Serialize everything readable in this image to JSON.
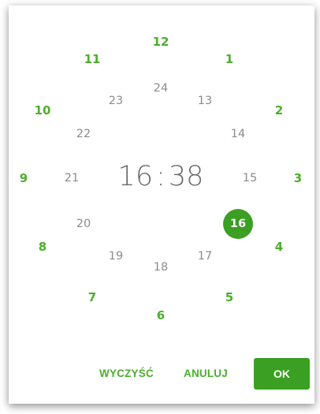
{
  "time_display": {
    "hours": "16",
    "separator": ":",
    "minutes": "38"
  },
  "clock": {
    "outer_hours": [
      "12",
      "1",
      "2",
      "3",
      "4",
      "5",
      "6",
      "7",
      "8",
      "9",
      "10",
      "11"
    ],
    "inner_hours": [
      "24",
      "13",
      "14",
      "15",
      "16",
      "17",
      "18",
      "19",
      "20",
      "21",
      "22",
      "23"
    ],
    "selected_hour": "16"
  },
  "actions": {
    "clear_label": "WYCZYŚĆ",
    "cancel_label": "ANULUJ",
    "ok_label": "OK"
  },
  "colors": {
    "accent": "#3a9f22",
    "outer_text": "#4cae2e",
    "inner_text": "#8c8c8c"
  }
}
